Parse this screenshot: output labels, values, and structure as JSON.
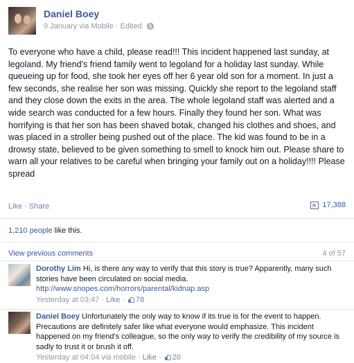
{
  "post": {
    "author": "Daniel Boey",
    "meta": {
      "date": "9 January",
      "via": "via Mobile",
      "separator": "·",
      "edited": "Edited",
      "privacy_icon": "globe-icon"
    },
    "body": "To everyone who have a child, please read!!! This incident happened last sunday, at legoland. My friend's friend family went to legoland for a holiday last sunday. While queueing up for food, she took her eyes off her 6 year old son for a moment. In just a few seconds, she realise her son was missing. Quickly she report to the legoland staff and they close down the exits in the area. The whole legoland staff was alerted and a wide search was conducted for a few hours. Finally they found her son. What was horrifying is that her son has been shaved botak, changed his clothes and shoes, and was placed in a stroller being pushed out of the place. The kid was found to be in a drowsy state, believed to be given something to smell to knock him out. Please share to warn all your relatives to be careful when bringing your family out on a holiday!!!! Please spread",
    "actions": {
      "like": "Like",
      "separator": "·",
      "share": "Share"
    },
    "share_count": "17,388",
    "likes_count": "1,210 people",
    "likes_suffix": " like this."
  },
  "comments_header": {
    "view_previous": "View previous comments",
    "position": "4 of 57"
  },
  "comments": [
    {
      "name": "Dorothy Lim",
      "text": "Hi, is there any way to verify that this story is true? Apparently, many such stories have been circulated on social media.",
      "link": "http://www.snopes.com/horrors/parental/kidnap.asp",
      "time": "Yesterday at 03:47",
      "separator": "·",
      "like": "Like",
      "likes": "78"
    },
    {
      "name": "Daniel Boey",
      "text": "Unfortunately the only way to know if its true is for the event to happen. Precautions are definitely safer like what everyone would emphasize. This incident happened on my friend's colleague, so the only way to verify the credibility of my source is sadly to trust it or brush it off.",
      "time": "Yesterday at 04:04 via mobile",
      "separator": "·",
      "like": "Like",
      "likes": "20"
    }
  ],
  "colors": {
    "link": "#3b5998",
    "meta": "#9197a3",
    "text": "#141823"
  }
}
